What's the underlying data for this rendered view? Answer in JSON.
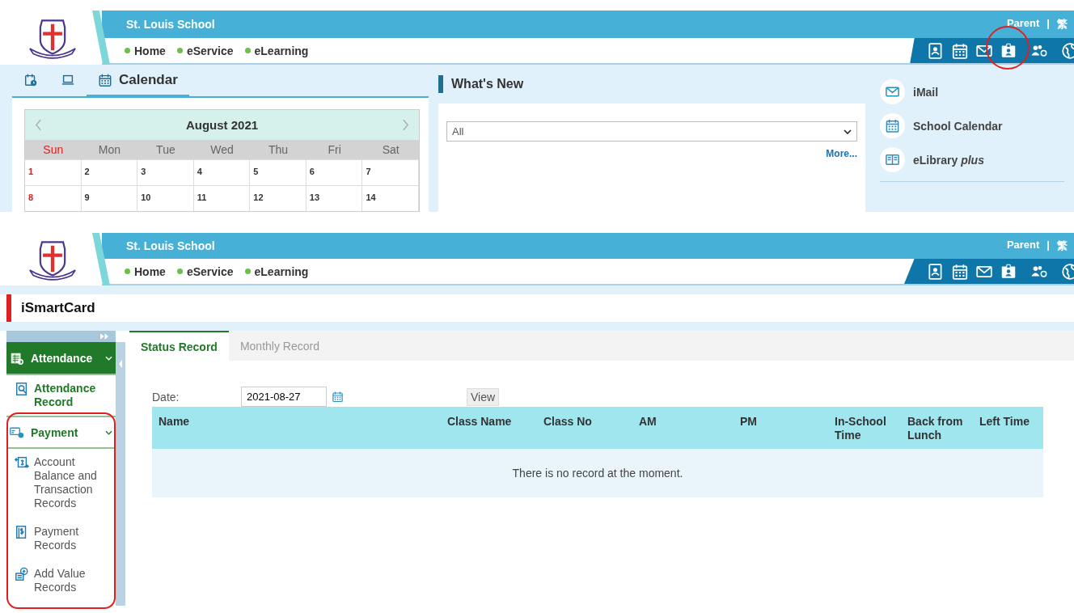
{
  "portal_screen": {
    "header": {
      "school_name": "St. Louis School",
      "user_links": [
        "Parent",
        "|",
        "繁"
      ],
      "nav": [
        "Home",
        "eService",
        "eLearning"
      ],
      "toolbar": [
        {
          "kind": "report",
          "highlighted": false
        },
        {
          "kind": "calendar",
          "highlighted": false
        },
        {
          "kind": "mail",
          "highlighted": false
        },
        {
          "kind": "id-card",
          "highlighted": true
        },
        {
          "kind": "users-gear",
          "highlighted": false
        },
        {
          "kind": "globe",
          "highlighted": false
        }
      ]
    },
    "tabs": [
      {
        "kind": "clock-calendar",
        "selected": false
      },
      {
        "kind": "laptop",
        "selected": false
      },
      {
        "kind": "calendar",
        "label": "Calendar",
        "selected": true
      }
    ],
    "calendar": {
      "month": "August 2021",
      "weekdays": [
        "Sun",
        "Mon",
        "Tue",
        "Wed",
        "Thu",
        "Fri",
        "Sat"
      ],
      "weeks": [
        [
          "1",
          "2",
          "3",
          "4",
          "5",
          "6",
          "7"
        ],
        [
          "8",
          "9",
          "10",
          "11",
          "12",
          "13",
          "14"
        ]
      ]
    },
    "whats_new": {
      "title": "What's New",
      "filter": "All",
      "more": "More..."
    },
    "shortcuts": [
      {
        "kind": "mail",
        "label": "iMail"
      },
      {
        "kind": "calendar",
        "label": "School Calendar"
      },
      {
        "kind": "book",
        "label": "eLibrary *plus*"
      }
    ]
  },
  "smartcard_screen": {
    "header": {
      "school_name": "St. Louis School",
      "user_links": [
        "Parent",
        "|",
        "繁"
      ],
      "nav": [
        "Home",
        "eService",
        "eLearning"
      ],
      "toolbar": [
        {
          "kind": "report",
          "highlighted": false
        },
        {
          "kind": "calendar",
          "highlighted": false
        },
        {
          "kind": "mail",
          "highlighted": false
        },
        {
          "kind": "id-card",
          "highlighted": false
        },
        {
          "kind": "users-gear",
          "highlighted": false
        },
        {
          "kind": "globe",
          "highlighted": false
        }
      ]
    },
    "page_title": "iSmartCard",
    "sidebar": [
      {
        "label": "Attendance",
        "kind": "attendance",
        "selected": true,
        "expanded": true,
        "highlighted": false,
        "items": [
          {
            "kind": "search-doc",
            "label": "Attendance Record",
            "selected": true
          }
        ]
      },
      {
        "label": "Payment",
        "kind": "payment",
        "selected": false,
        "expanded": true,
        "highlighted": true,
        "items": [
          {
            "kind": "exchange",
            "label": "Account Balance and Transaction Records",
            "selected": false
          },
          {
            "kind": "bill",
            "label": "Payment Records",
            "selected": false
          },
          {
            "kind": "add-value",
            "label": "Add Value Records",
            "selected": false
          }
        ]
      }
    ],
    "tabs": [
      {
        "label": "Status Record",
        "selected": true
      },
      {
        "label": "Monthly Record",
        "selected": false
      }
    ],
    "date_label": "Date:",
    "date_value": "2021-08-27",
    "view_button": "View",
    "table": {
      "columns": [
        "Name",
        "Class Name",
        "Class No",
        "AM",
        "PM",
        "In-School Time",
        "Back from Lunch",
        "Left Time"
      ],
      "empty_message": "There is no record at the moment."
    }
  }
}
